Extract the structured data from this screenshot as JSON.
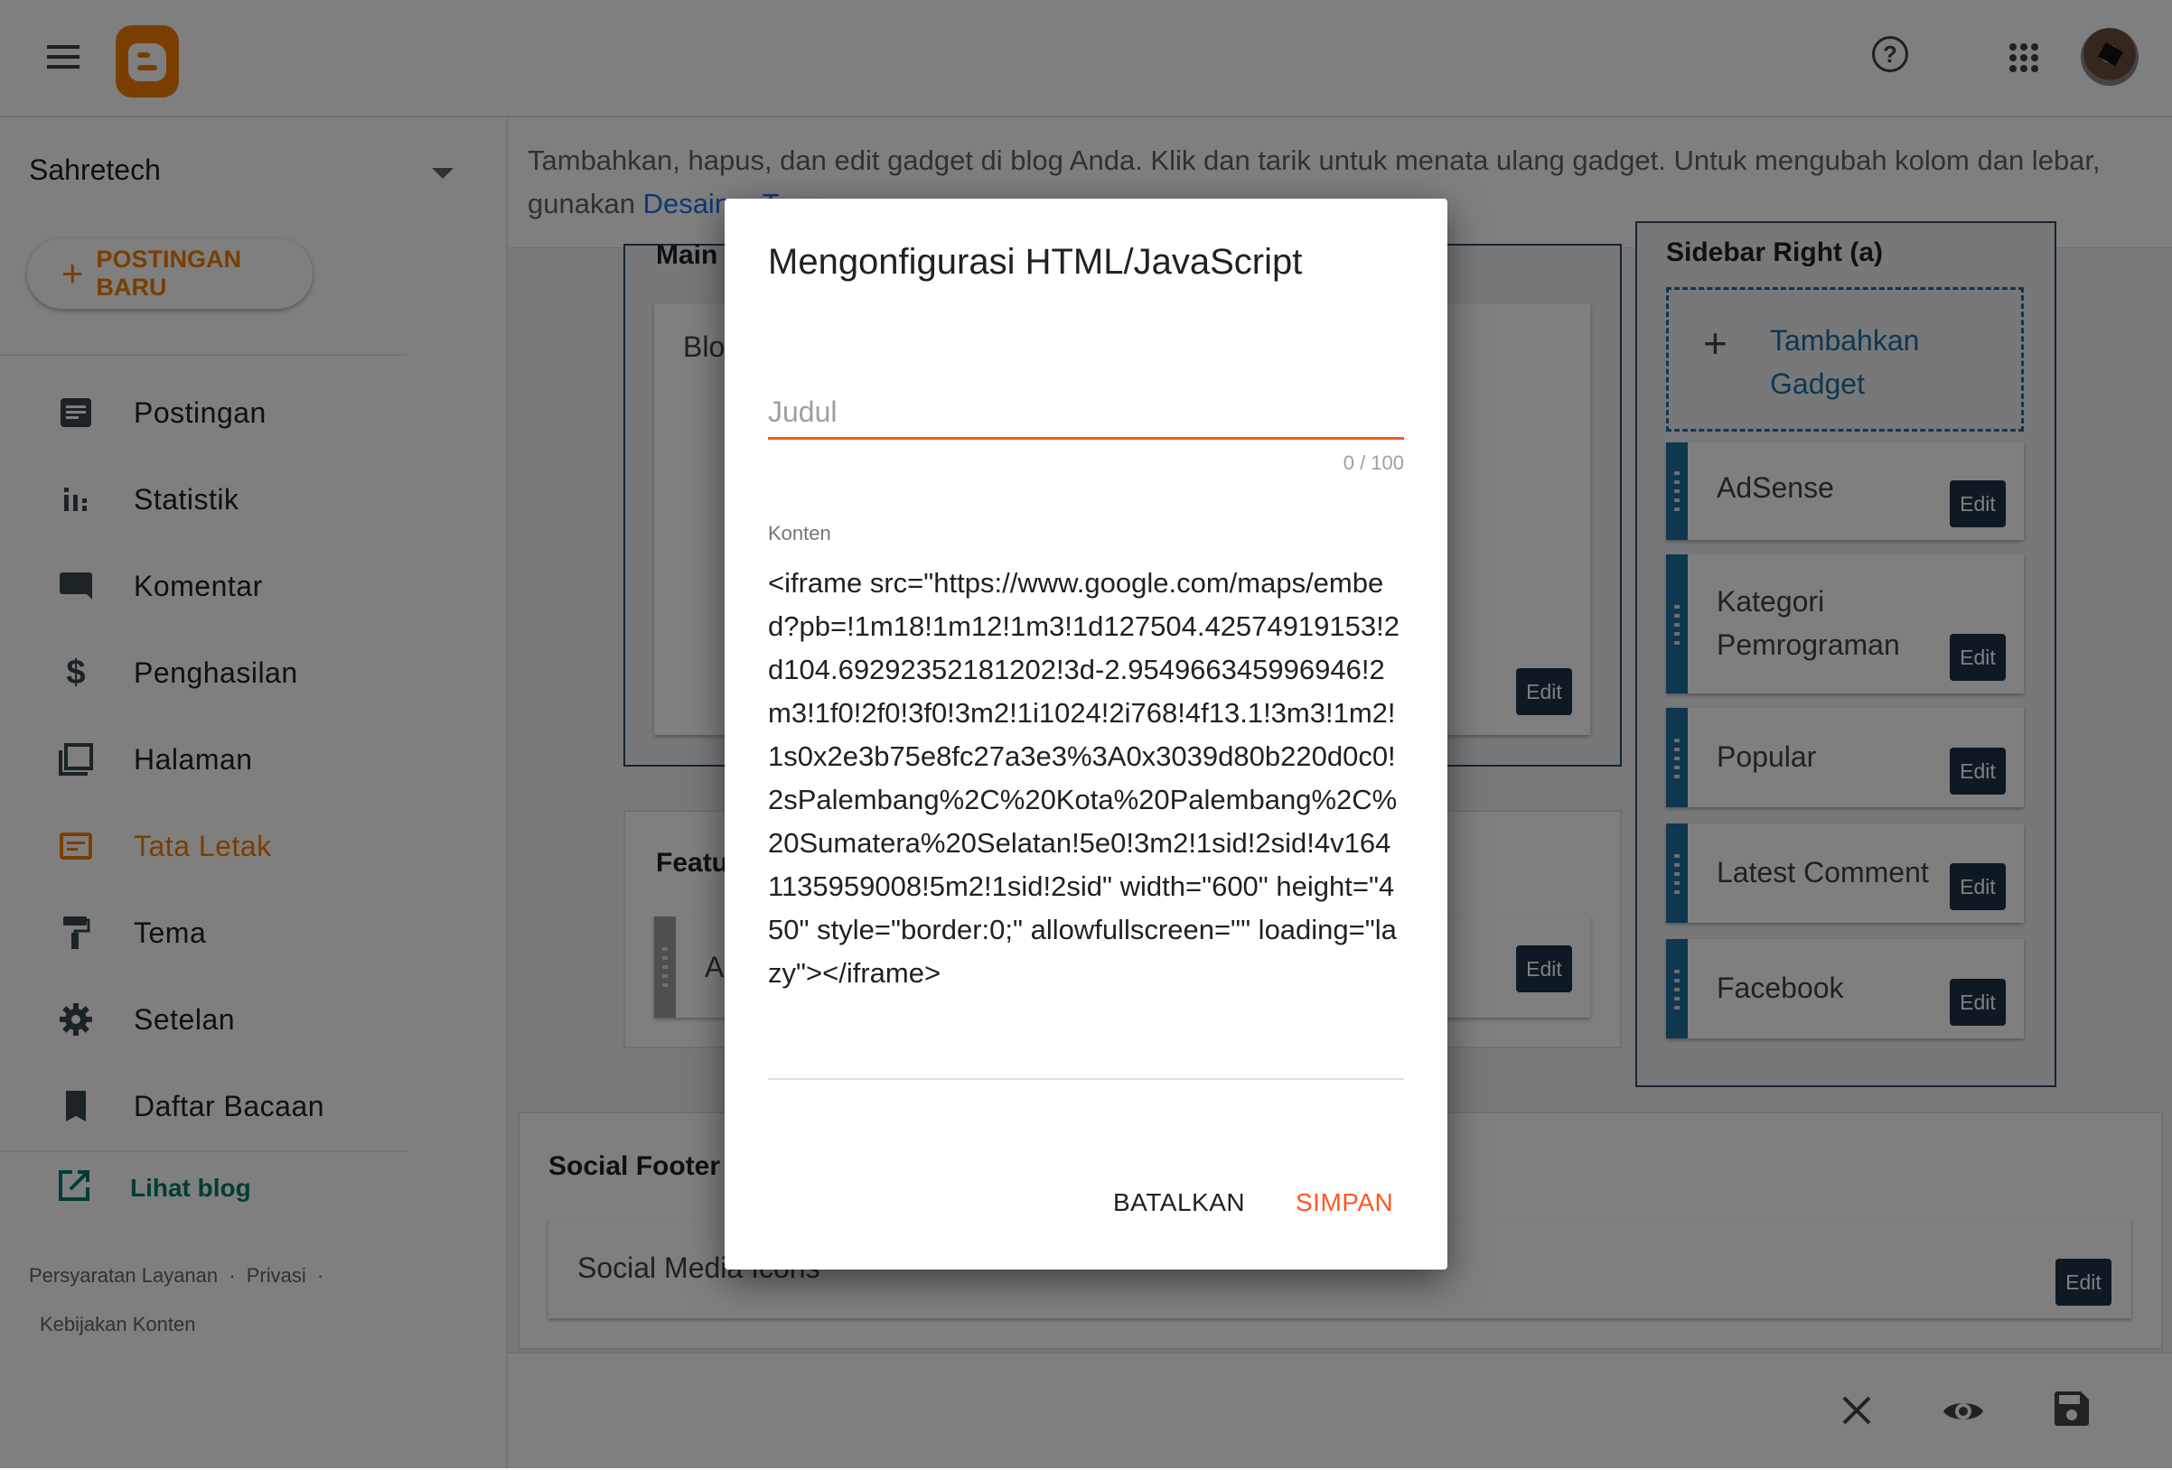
{
  "header": {
    "menu_icon": "hamburger-menu-icon",
    "logo_icon": "blogger-logo-icon",
    "help_icon": "help-circle-icon",
    "apps_icon": "apps-grid-icon",
    "avatar": "user-avatar"
  },
  "sidebar": {
    "blog_name": "Sahretech",
    "new_post_label": "POSTINGAN BARU",
    "items": [
      {
        "label": "Postingan",
        "icon": "posts-icon",
        "active": false
      },
      {
        "label": "Statistik",
        "icon": "stats-icon",
        "active": false
      },
      {
        "label": "Komentar",
        "icon": "comment-icon",
        "active": false
      },
      {
        "label": "Penghasilan",
        "icon": "dollar-icon",
        "active": false
      },
      {
        "label": "Halaman",
        "icon": "pages-icon",
        "active": false
      },
      {
        "label": "Tata Letak",
        "icon": "layout-icon",
        "active": true
      },
      {
        "label": "Tema",
        "icon": "paint-roller-icon",
        "active": false
      },
      {
        "label": "Setelan",
        "icon": "gear-icon",
        "active": false
      },
      {
        "label": "Daftar Bacaan",
        "icon": "bookmark-icon",
        "active": false
      }
    ],
    "view_blog_label": "Lihat blog",
    "footer_links": [
      "Persyaratan Layanan",
      "Privasi",
      "Kebijakan Konten"
    ],
    "separator": "·"
  },
  "main": {
    "description": "Tambahkan, hapus, dan edit gadget di blog Anda. Klik dan tarik untuk menata ulang gadget. Untuk mengubah kolom dan lebar, gunakan ",
    "description_link": "Desainer Tema",
    "main_section": {
      "title": "Main",
      "gadget": "Blog Posts",
      "edit_label": "Edit"
    },
    "featured_section": {
      "title": "Featured Post",
      "gadget": "A",
      "edit_label": "Edit"
    },
    "sidebar_right": {
      "title": "Sidebar Right (a)",
      "add_gadget_label": "Tambahkan Gadget",
      "gadgets": [
        {
          "name": "AdSense",
          "edit_label": "Edit"
        },
        {
          "name": "Kategori Pemrograman",
          "edit_label": "Edit"
        },
        {
          "name": "Popular",
          "edit_label": "Edit"
        },
        {
          "name": "Latest Comment",
          "edit_label": "Edit"
        },
        {
          "name": "Facebook",
          "edit_label": "Edit"
        }
      ]
    },
    "social_footer": {
      "title": "Social Footer",
      "gadget": "Social Media Icons",
      "edit_label": "Edit"
    }
  },
  "bottom_bar": {
    "close_icon": "close-icon",
    "preview_icon": "eye-icon",
    "save_icon": "save-floppy-icon"
  },
  "dialog": {
    "title": "Mengonfigurasi HTML/JavaScript",
    "title_field": {
      "placeholder": "Judul",
      "value": "",
      "counter": "0 / 100"
    },
    "content_label": "Konten",
    "content_value": "<iframe src=\"https://www.google.com/maps/embed?pb=!1m18!1m12!1m3!1d127504.42574919153!2d104.69292352181202!3d-2.954966345996946!2m3!1f0!2f0!3f0!3m2!1i1024!2i768!4f13.1!3m3!1m2!1s0x2e3b75e8fc27a3e3%3A0x3039d80b220d0c0!2sPalembang%2C%20Kota%20Palembang%2C%20Sumatera%20Selatan!5e0!3m2!1sid!2sid!4v1641135959008!5m2!1sid!2sid\" width=\"600\" height=\"450\" style=\"border:0;\" allowfullscreen=\"\" loading=\"lazy\"></iframe>",
    "cancel_label": "BATALKAN",
    "save_label": "SIMPAN",
    "accent_color": "#ff5722"
  }
}
